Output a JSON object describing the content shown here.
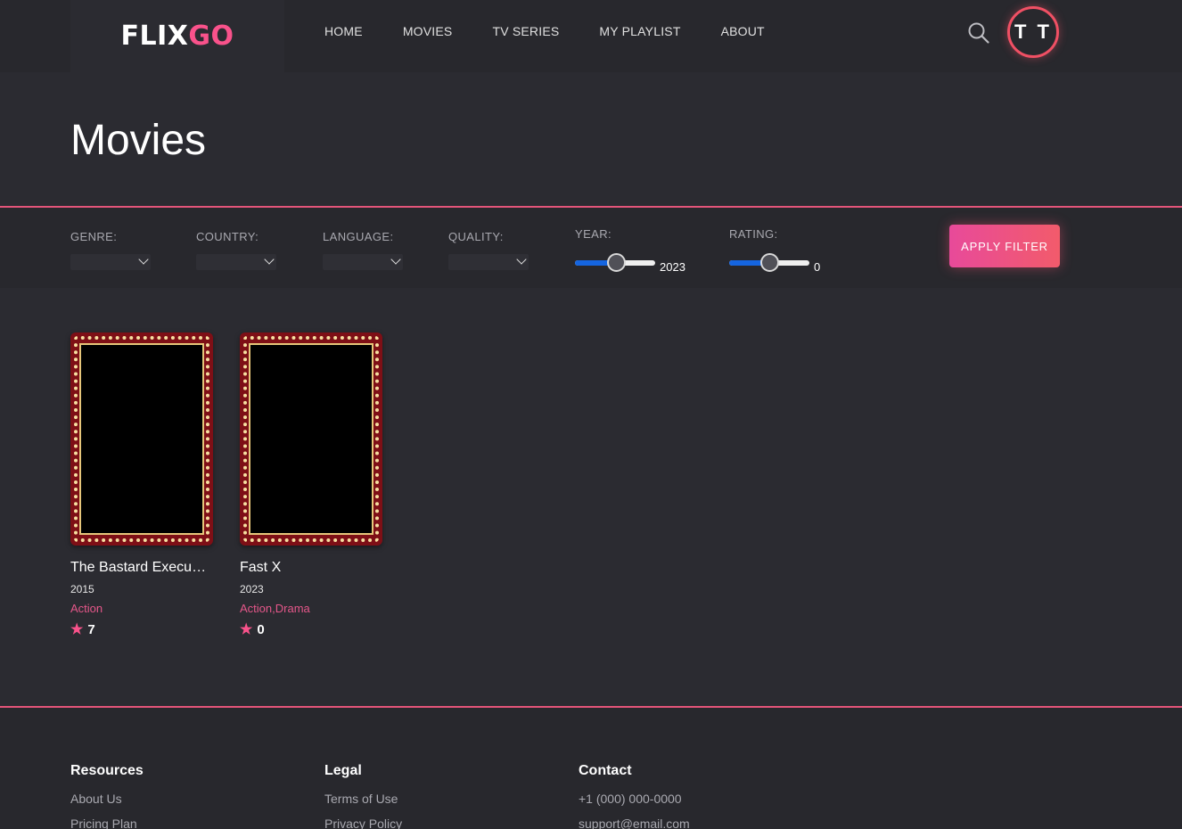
{
  "header": {
    "logo_part1": "FLIX",
    "logo_part2": "GO",
    "nav": [
      "HOME",
      "MOVIES",
      "TV SERIES",
      "MY PLAYLIST",
      "ABOUT"
    ],
    "avatar_initials": "T T"
  },
  "page": {
    "title": "Movies"
  },
  "filters": {
    "genre_label": "GENRE:",
    "country_label": "COUNTRY:",
    "language_label": "LANGUAGE:",
    "quality_label": "QUALITY:",
    "year_label": "YEAR:",
    "year_value": "2023",
    "year_fraction": 0.52,
    "rating_label": "RATING:",
    "rating_value": "0",
    "rating_fraction": 0.5,
    "apply_label": "APPLY FILTER"
  },
  "movies": [
    {
      "title": "The Bastard Executioner",
      "year": "2015",
      "genres": "Action",
      "rating": "7"
    },
    {
      "title": "Fast X",
      "year": "2023",
      "genres": "Action,Drama",
      "rating": "0"
    }
  ],
  "footer": {
    "resources": {
      "heading": "Resources",
      "links": [
        "About Us",
        "Pricing Plan"
      ]
    },
    "legal": {
      "heading": "Legal",
      "links": [
        "Terms of Use",
        "Privacy Policy"
      ]
    },
    "contact": {
      "heading": "Contact",
      "links": [
        "+1 (000) 000-0000",
        "support@email.com"
      ]
    }
  },
  "colors": {
    "accent": "#f9528b",
    "divider": "#e4557a",
    "slider_fill": "#1565e0"
  },
  "icons": {
    "search": "search-icon",
    "star": "star-icon"
  }
}
